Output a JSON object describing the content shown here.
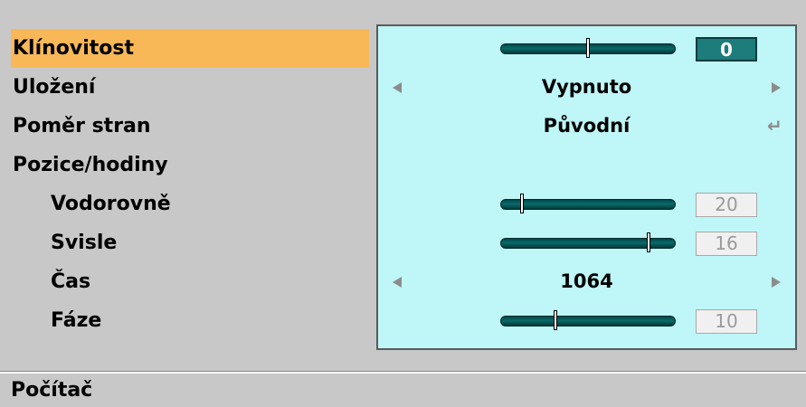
{
  "menu": {
    "items": [
      {
        "label": "Klínovitost",
        "selected": true
      },
      {
        "label": "Uložení"
      },
      {
        "label": "Poměr stran"
      },
      {
        "label": "Pozice/hodiny"
      },
      {
        "label": "Vodorovně"
      },
      {
        "label": "Svisle"
      },
      {
        "label": "Čas"
      },
      {
        "label": "Fáze"
      }
    ]
  },
  "panel": {
    "keystone": {
      "value": "0",
      "level": 0.5
    },
    "memory": {
      "value": "Vypnuto"
    },
    "aspect": {
      "value": "Původní"
    },
    "horizontal": {
      "value": "20",
      "level": 0.12
    },
    "vertical": {
      "value": "16",
      "level": 0.85
    },
    "clock": {
      "value": "1064"
    },
    "phase": {
      "value": "10",
      "level": 0.31
    }
  },
  "footer": {
    "label": "Počítač"
  },
  "colors": {
    "selected_bg": "#f8b858",
    "panel_bg": "#bff6f8",
    "slider": "#0c6a6a",
    "active_box": "#1d7c7c"
  },
  "icons": [
    "arrow-left-icon",
    "arrow-right-icon",
    "enter-icon"
  ]
}
